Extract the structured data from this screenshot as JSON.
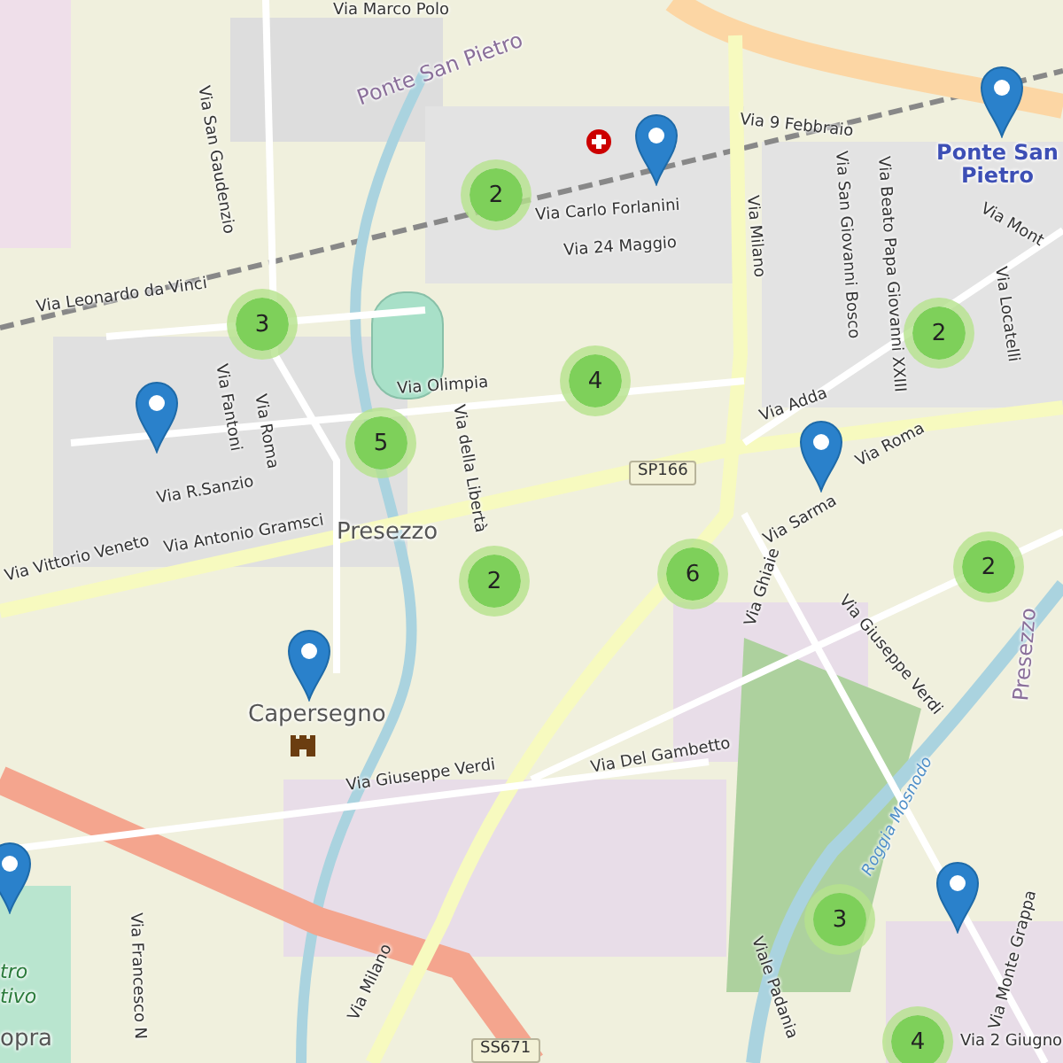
{
  "map": {
    "labels": [
      {
        "text": "Via Marco Polo",
        "kind": "street"
      },
      {
        "text": "Via San Gaudenzio",
        "kind": "street"
      },
      {
        "text": "Ponte San Pietro",
        "kind": "district"
      },
      {
        "text": "Via Carlo Forlanini",
        "kind": "street"
      },
      {
        "text": "Via 24 Maggio",
        "kind": "street"
      },
      {
        "text": "Via 9 Febbraio",
        "kind": "street"
      },
      {
        "text": "Ponte San Pietro",
        "kind": "station"
      },
      {
        "text": "Via Milano",
        "kind": "street"
      },
      {
        "text": "Via Leonardo da Vinci",
        "kind": "street"
      },
      {
        "text": "Via Fantoni",
        "kind": "street"
      },
      {
        "text": "Via Roma",
        "kind": "street"
      },
      {
        "text": "Via Olimpia",
        "kind": "street"
      },
      {
        "text": "Via della Libertà",
        "kind": "street"
      },
      {
        "text": "Via R.Sanzio",
        "kind": "street"
      },
      {
        "text": "Via Antonio Gramsci",
        "kind": "street"
      },
      {
        "text": "SP166",
        "kind": "shield"
      },
      {
        "text": "Presezzo",
        "kind": "town"
      },
      {
        "text": "Via Vittorio Veneto",
        "kind": "street"
      },
      {
        "text": "Capersegno",
        "kind": "town"
      },
      {
        "text": "Via Giuseppe Verdi",
        "kind": "street"
      },
      {
        "text": "Via Del Gambetto",
        "kind": "street"
      },
      {
        "text": "Via Ghiaie",
        "kind": "street"
      },
      {
        "text": "Via Adda",
        "kind": "street"
      },
      {
        "text": "Via Roma",
        "kind": "street"
      },
      {
        "text": "Via Sarma",
        "kind": "street"
      },
      {
        "text": "Via Beato Papa Giovanni XXIII",
        "kind": "street"
      },
      {
        "text": "Via San Giovanni Bosco",
        "kind": "street"
      },
      {
        "text": "Via Locatelli",
        "kind": "street"
      },
      {
        "text": "Via Mont",
        "kind": "street"
      },
      {
        "text": "Via Giuseppe Verdi",
        "kind": "street"
      },
      {
        "text": "Roggia Mosnodo",
        "kind": "water"
      },
      {
        "text": "Viale Padania",
        "kind": "street"
      },
      {
        "text": "Via Monte Grappa",
        "kind": "street"
      },
      {
        "text": "SS671",
        "kind": "shield"
      },
      {
        "text": "Via 2 Giugno",
        "kind": "street"
      },
      {
        "text": "Via Francesco N",
        "kind": "street"
      },
      {
        "text": "tro",
        "kind": "park"
      },
      {
        "text": "tivo",
        "kind": "park"
      },
      {
        "text": "opra",
        "kind": "town"
      },
      {
        "text": "Via Milano",
        "kind": "street"
      },
      {
        "text": "Presezzo",
        "kind": "district"
      }
    ],
    "clusters": [
      {
        "count": "2"
      },
      {
        "count": "3"
      },
      {
        "count": "4"
      },
      {
        "count": "5"
      },
      {
        "count": "2"
      },
      {
        "count": "6"
      },
      {
        "count": "2"
      },
      {
        "count": "2"
      },
      {
        "count": "3"
      },
      {
        "count": "4"
      }
    ]
  }
}
